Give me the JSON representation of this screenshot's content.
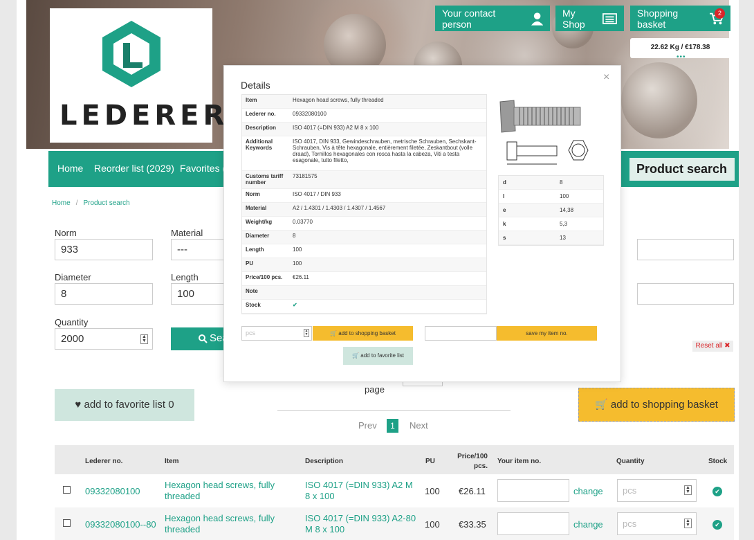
{
  "header": {
    "brand": "LEDERER",
    "hero_fragment": "o",
    "contact_label": "Your contact person",
    "myshop_label": "My Shop",
    "basket_label": "Shopping basket",
    "basket_count": "2",
    "basket_summary": "22.62 Kg / €178.38"
  },
  "nav": {
    "items": [
      "Home",
      "Reorder list (2029)",
      "Favorites (115)"
    ],
    "product_search": "Product search"
  },
  "breadcrumb": [
    "Home",
    "Product search"
  ],
  "form": {
    "norm_label": "Norm",
    "norm_value": "933",
    "material_label": "Material",
    "material_value": "---",
    "diameter_label": "Diameter",
    "diameter_value": "8",
    "length_label": "Length",
    "length_value": "100",
    "quantity_label": "Quantity",
    "quantity_value": "2000",
    "search_label": "Search",
    "reset_label": "Reset all ✖"
  },
  "actions": {
    "fav_label": "add to favorite list 0",
    "basket_label": "add to shopping basket",
    "page_label": "page",
    "prev": "Prev",
    "current_page": "1",
    "next": "Next"
  },
  "table": {
    "headers": [
      "Lederer no.",
      "Item",
      "Description",
      "PU",
      "Price/100 pcs.",
      "Your item no.",
      "Quantity",
      "Stock"
    ],
    "rows": [
      {
        "no": "09332080100",
        "item": "Hexagon head screws, fully threaded",
        "desc": "ISO 4017 (=DIN 933) A2 M 8 x 100",
        "pu": "100",
        "price": "€26.11",
        "change": "change",
        "qty_placeholder": "pcs"
      },
      {
        "no": "09332080100--80",
        "item": "Hexagon head screws, fully threaded",
        "desc": "ISO 4017 (=DIN 933) A2-80 M 8 x 100",
        "pu": "100",
        "price": "€33.35",
        "change": "change",
        "qty_placeholder": "pcs"
      }
    ]
  },
  "modal": {
    "title": "Details",
    "close": "×",
    "details": [
      {
        "k": "Item",
        "v": "Hexagon head screws, fully threaded"
      },
      {
        "k": "Lederer no.",
        "v": "09332080100"
      },
      {
        "k": "Description",
        "v": "ISO 4017 (=DIN 933) A2 M 8 x 100"
      },
      {
        "k": "Additional Keywords",
        "v": "ISO 4017, DIN 933, Gewindeschrauben, metrische Schrauben, Sechskant-Schrauben, Vis à tête hexagonale, entièrement filetée, Zeskantbout (volle draad), Tornillos hexagonales con rosca hasta la cabeza, Viti a testa esagonale, tutto filetto,"
      },
      {
        "k": "Customs tariff number",
        "v": "73181575"
      },
      {
        "k": "Norm",
        "v": "ISO 4017 / DIN 933"
      },
      {
        "k": "Material",
        "v": "A2 / 1.4301 / 1.4303 / 1.4307 / 1.4567"
      },
      {
        "k": "Weight/kg",
        "v": "0.03770"
      },
      {
        "k": "Diameter",
        "v": "8"
      },
      {
        "k": "Length",
        "v": "100"
      },
      {
        "k": "PU",
        "v": "100"
      },
      {
        "k": "Price/100 pcs.",
        "v": "€26.11"
      },
      {
        "k": "Note",
        "v": ""
      },
      {
        "k": "Stock",
        "v": "✔"
      }
    ],
    "measures": [
      {
        "k": "d",
        "v": "8"
      },
      {
        "k": "l",
        "v": "100"
      },
      {
        "k": "e",
        "v": "14,38"
      },
      {
        "k": "k",
        "v": "5,3"
      },
      {
        "k": "s",
        "v": "13"
      }
    ],
    "pcs_placeholder": "pcs",
    "add_basket": "add to shopping basket",
    "save_item": "save my item no.",
    "add_fav": "add to favorite list"
  },
  "colors": {
    "accent": "#1ea187",
    "warning": "#f5bc2e",
    "danger": "#d9262a"
  }
}
